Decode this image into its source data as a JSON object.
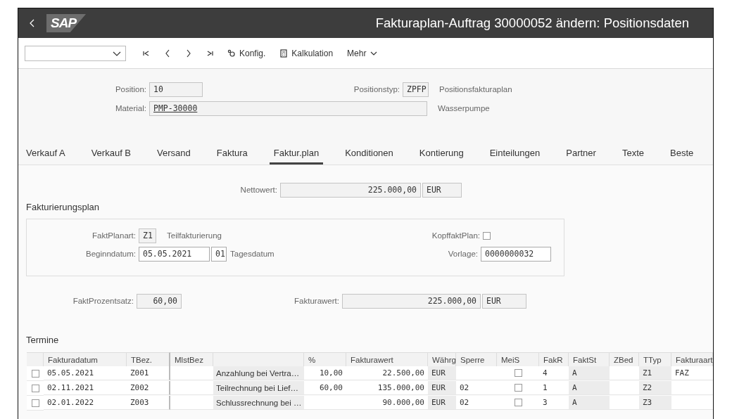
{
  "window": {
    "title": "Fakturaplan-Auftrag 30000052 ändern: Positionsdaten",
    "logo": "SAP"
  },
  "toolbar": {
    "buttons": [
      {
        "label": "Konfig.",
        "kind": "gear"
      },
      {
        "label": "Kalkulation",
        "kind": "calc"
      },
      {
        "label": "Mehr",
        "kind": "menu"
      }
    ]
  },
  "header": {
    "position": {
      "label": "Position:",
      "value": "10"
    },
    "item_type": {
      "label": "Positionstyp:",
      "value": "ZPFP",
      "description": "Positionsfakturaplan"
    },
    "material": {
      "label": "Material:",
      "value": "PMP-30000",
      "description": "Wasserpumpe"
    }
  },
  "tabs": [
    {
      "label": "Verkauf A",
      "selected": false
    },
    {
      "label": "Verkauf B",
      "selected": false
    },
    {
      "label": "Versand",
      "selected": false
    },
    {
      "label": "Faktura",
      "selected": false
    },
    {
      "label": "Faktur.plan",
      "selected": true
    },
    {
      "label": "Konditionen",
      "selected": false
    },
    {
      "label": "Kontierung",
      "selected": false
    },
    {
      "label": "Einteilungen",
      "selected": false
    },
    {
      "label": "Partner",
      "selected": false
    },
    {
      "label": "Texte",
      "selected": false
    },
    {
      "label": "Beste",
      "selected": false
    }
  ],
  "net_value": {
    "label": "Nettowert:",
    "value": "225.000,00",
    "currency": "EUR"
  },
  "billing_plan": {
    "title": "Fakturierungsplan",
    "plan_type": {
      "label": "FaktPlanart:",
      "value": "Z1",
      "description": "Teilfakturierung"
    },
    "start_date": {
      "label": "Beginndatum:",
      "value": "05.05.2021",
      "rule": "01",
      "description": "Tagesdatum",
      "editable": true
    },
    "header_plan": {
      "label": "KopffaktPlan:",
      "checked": false
    },
    "template": {
      "label": "Vorlage:",
      "value": "0000000032",
      "editable": true
    }
  },
  "percentage": {
    "label": "FaktProzentsatz:",
    "value": "60,00"
  },
  "billing_value": {
    "label": "Fakturawert:",
    "value": "225.000,00",
    "currency": "EUR"
  },
  "dates": {
    "title": "Termine",
    "columns": [
      {
        "label": "Fakturadatum",
        "kind": "text",
        "shaded": false
      },
      {
        "label": "TBez.",
        "kind": "text",
        "shaded": false
      },
      {
        "label": "MlstBez",
        "kind": "text",
        "shaded": false
      },
      {
        "kind": "text",
        "shaded": true
      },
      {
        "label": "%",
        "kind": "number",
        "shaded": false
      },
      {
        "label": "Fakturawert",
        "kind": "number",
        "shaded": false
      },
      {
        "label": "Währg",
        "kind": "text",
        "shaded": true
      },
      {
        "label": "Sperre",
        "kind": "text",
        "shaded": false
      },
      {
        "label": "MeiS",
        "kind": "check",
        "shaded": false
      },
      {
        "label": "FakR",
        "kind": "text",
        "shaded": false
      },
      {
        "label": "FaktSt",
        "kind": "text",
        "shaded": true
      },
      {
        "label": "ZBed",
        "kind": "text",
        "shaded": false
      },
      {
        "label": "TTyp",
        "kind": "text",
        "shaded": true
      },
      {
        "label": "Fakturaart",
        "kind": "text",
        "shaded": false
      }
    ],
    "rows": [
      {
        "selected": false,
        "cells": [
          "05.05.2021",
          "Z001",
          null,
          "Anzahlung bei Vertra…",
          "10,00",
          "22.500,00",
          "EUR",
          null,
          {
            "checked": false
          },
          "4",
          "A",
          null,
          "Z1",
          "FAZ"
        ]
      },
      {
        "selected": false,
        "cells": [
          "02.11.2021",
          "Z002",
          null,
          "Teilrechnung bei Lief…",
          "60,00",
          "135.000,00",
          "EUR",
          "02",
          {
            "checked": false
          },
          "1",
          "A",
          null,
          "Z2",
          null
        ]
      },
      {
        "selected": false,
        "cells": [
          "02.01.2022",
          "Z003",
          null,
          "Schlussrechnung bei …",
          null,
          "90.000,00",
          "EUR",
          "02",
          {
            "checked": false
          },
          "3",
          "A",
          null,
          "Z3",
          null
        ]
      }
    ]
  }
}
